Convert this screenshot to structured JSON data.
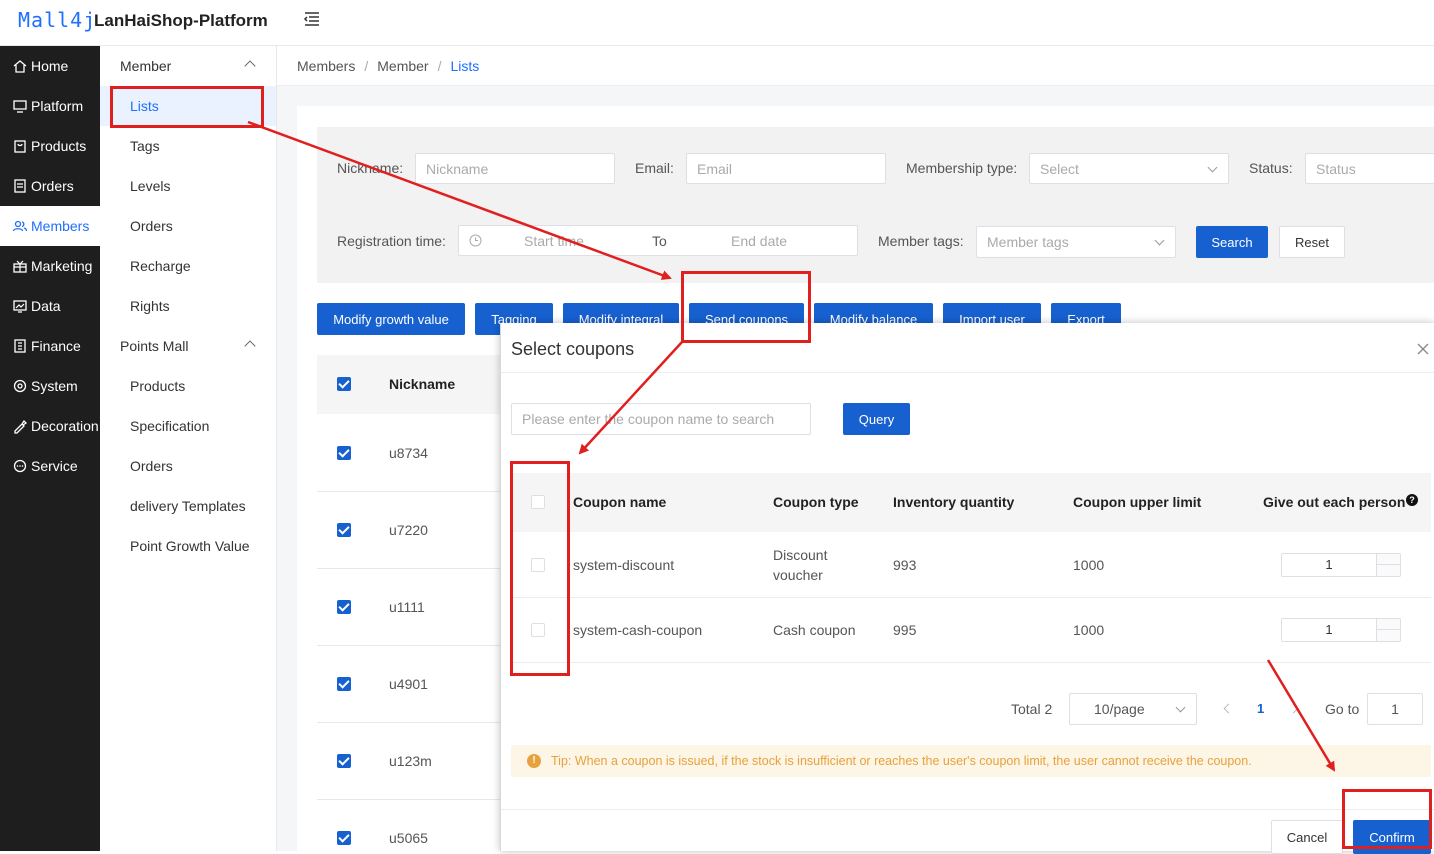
{
  "header": {
    "logo": "Mall4j",
    "title": "LanHaiShop-Platform"
  },
  "sidebar": {
    "items": [
      {
        "label": "Home",
        "icon": "home-icon"
      },
      {
        "label": "Platform",
        "icon": "monitor-icon"
      },
      {
        "label": "Products",
        "icon": "bag-icon"
      },
      {
        "label": "Orders",
        "icon": "document-icon"
      },
      {
        "label": "Members",
        "icon": "users-icon",
        "active": true
      },
      {
        "label": "Marketing",
        "icon": "gift-icon"
      },
      {
        "label": "Data",
        "icon": "chart-icon"
      },
      {
        "label": "Finance",
        "icon": "ledger-icon"
      },
      {
        "label": "System",
        "icon": "gear-icon"
      },
      {
        "label": "Decoration",
        "icon": "brush-icon"
      },
      {
        "label": "Service",
        "icon": "chat-icon"
      }
    ]
  },
  "submenu": {
    "group1": "Member",
    "group1_items": [
      "Lists",
      "Tags",
      "Levels",
      "Orders",
      "Recharge",
      "Rights"
    ],
    "group2": "Points Mall",
    "group2_items": [
      "Products",
      "Specification",
      "Orders",
      "delivery Templates",
      "Point Growth Value"
    ]
  },
  "breadcrumb": [
    "Members",
    "Member",
    "Lists"
  ],
  "filter": {
    "nickname_label": "Nickname:",
    "nickname_ph": "Nickname",
    "email_label": "Email:",
    "email_ph": "Email",
    "membership_label": "Membership type:",
    "membership_ph": "Select",
    "status_label": "Status:",
    "status_ph": "Status",
    "regtime_label": "Registration time:",
    "start_ph": "Start time",
    "to": "To",
    "end_ph": "End date",
    "tags_label": "Member tags:",
    "tags_ph": "Member tags",
    "search": "Search",
    "reset": "Reset"
  },
  "actions": [
    "Modify growth value",
    "Tagging",
    "Modify integral",
    "Send coupons",
    "Modify balance",
    "Import user",
    "Export"
  ],
  "table": {
    "header": "Nickname",
    "rows": [
      "u8734",
      "u7220",
      "u1111",
      "u4901",
      "u123m",
      "u5065"
    ]
  },
  "dialog": {
    "title": "Select coupons",
    "search_ph": "Please enter the coupon name to search",
    "query": "Query",
    "columns": [
      "Coupon name",
      "Coupon type",
      "Inventory quantity",
      "Coupon upper limit",
      "Give out each person"
    ],
    "rows": [
      {
        "name": "system-discount",
        "type_l1": "Discount",
        "type_l2": "voucher",
        "inventory": "993",
        "limit": "1000",
        "each": "1"
      },
      {
        "name": "system-cash-coupon",
        "type_l1": "Cash coupon",
        "type_l2": "",
        "inventory": "995",
        "limit": "1000",
        "each": "1"
      }
    ],
    "total": "Total 2",
    "page_size": "10/page",
    "page": "1",
    "goto_label": "Go to",
    "goto_value": "1",
    "tip": "Tip: When a coupon is issued, if the stock is insufficient or reaches the user's coupon limit, the user cannot receive the coupon.",
    "cancel": "Cancel",
    "confirm": "Confirm"
  },
  "colors": {
    "accent": "#1660d0",
    "annotation": "#e0201f",
    "sidebar_bg": "#1e1e1e",
    "warning": "#e6a23c"
  }
}
